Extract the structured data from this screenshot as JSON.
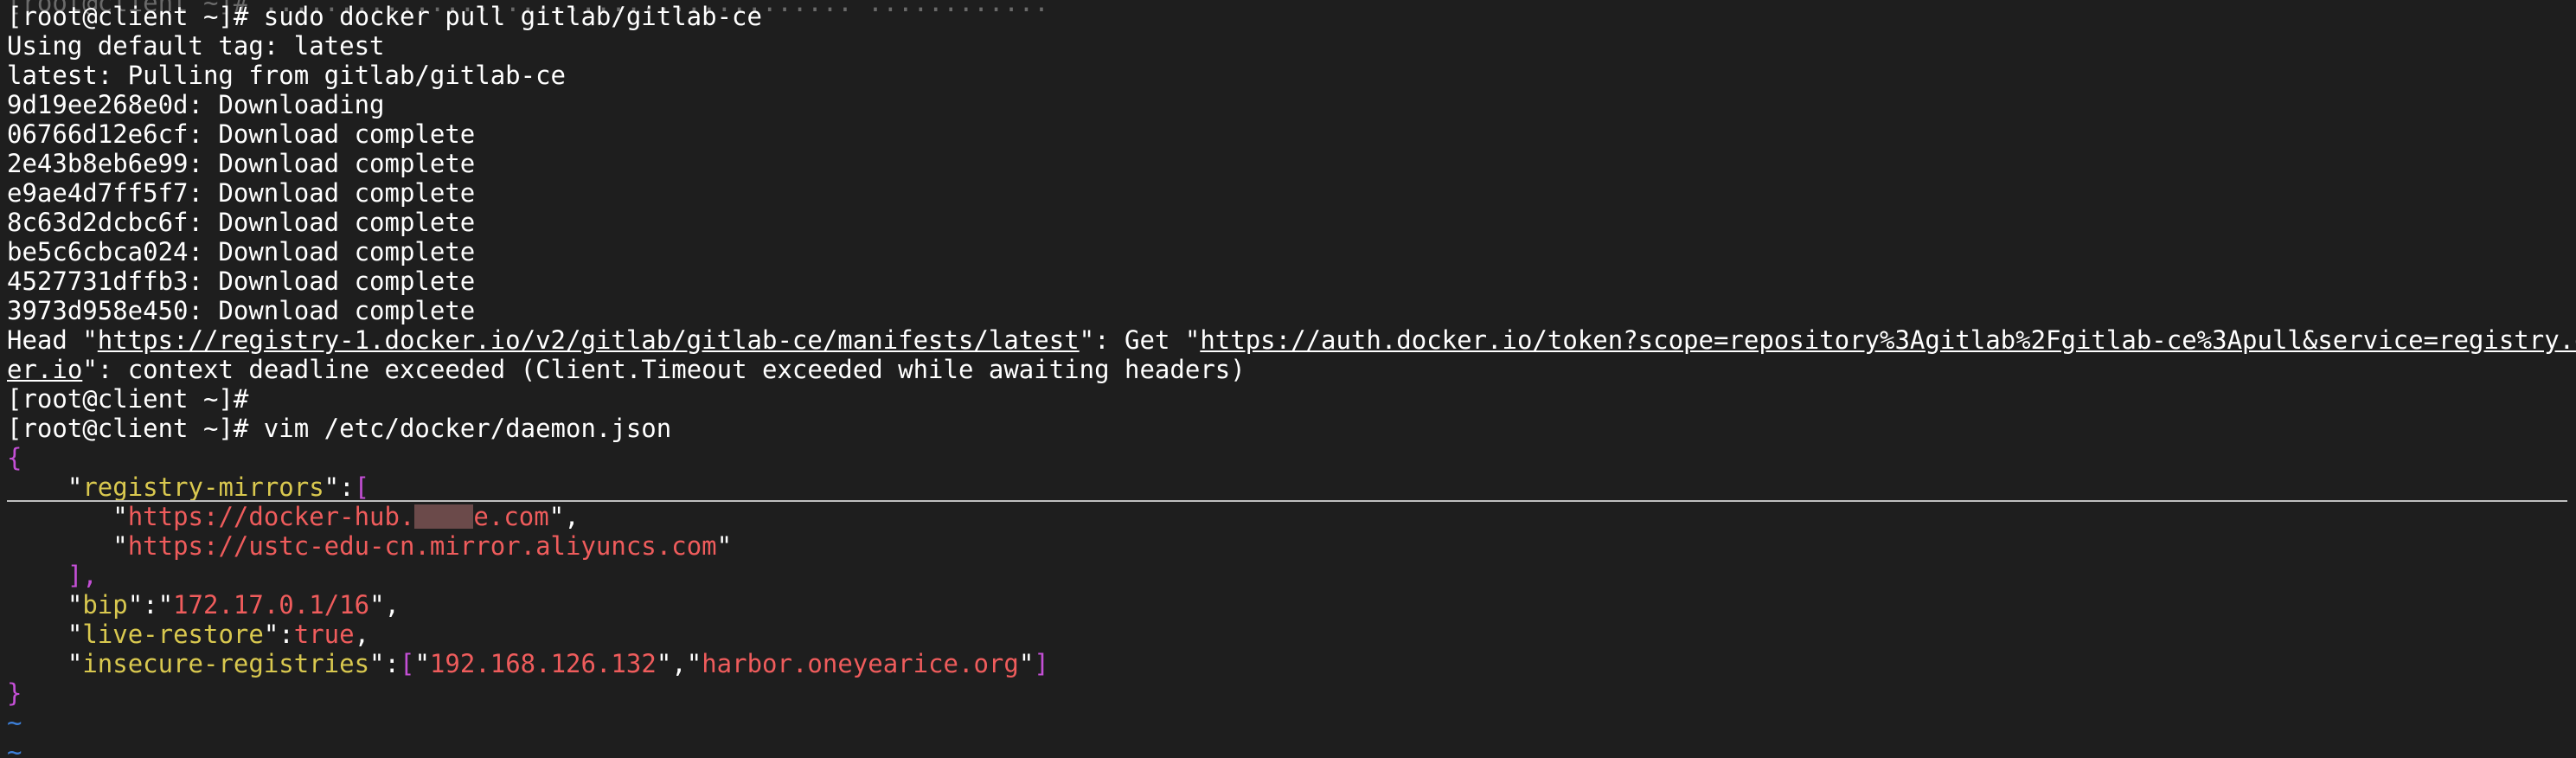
{
  "terminal": {
    "top_remnant": "[root@client ~]# ....................................... ............",
    "lines": {
      "l1": "[root@client ~]# sudo docker pull gitlab/gitlab-ce",
      "l2": "Using default tag: latest",
      "l3": "latest: Pulling from gitlab/gitlab-ce",
      "l4": "9d19ee268e0d: Downloading",
      "l5": "06766d12e6cf: Download complete",
      "l6": "2e43b8eb6e99: Download complete",
      "l7": "e9ae4d7ff5f7: Download complete",
      "l8": "8c63d2dcbc6f: Download complete",
      "l9": "be5c6cbca024: Download complete",
      "l10": "4527731dffb3: Download complete",
      "l11": "3973d958e450: Download complete"
    },
    "head_line": {
      "prefix": "Head \"",
      "url1": "https://registry-1.docker.io/v2/gitlab/gitlab-ce/manifests/latest",
      "middle": "\": Get \"",
      "url2_part1": "https://auth.docker.io/token?scope=repository%3Agitlab%2Fgitlab-ce%3Apull&service=registry.dock",
      "url2_part2": "er.io",
      "suffix": "\": context deadline exceeded (Client.Timeout exceeded while awaiting headers)"
    },
    "prompt_empty": "[root@client ~]#",
    "prompt_vim": "[root@client ~]# vim /etc/docker/daemon.json"
  },
  "editor": {
    "open_brace": "{",
    "indent": "    ",
    "indent2": "       ",
    "key_registry_mirrors": "registry-mirrors",
    "open_bracket": "[",
    "mirror1_before": "https://docker-hub.",
    "mirror1_after": "e.com",
    "mirror2": "https://ustc-edu-cn.mirror.aliyuncs.com",
    "close_bracket": "],",
    "key_bip": "bip",
    "val_bip": "172.17.0.1/16",
    "key_live_restore": "live-restore",
    "val_live_restore": "true",
    "key_insecure": "insecure-registries",
    "insecure1": "192.168.126.132",
    "insecure2": "harbor.oneyearice.org",
    "close_brace": "}",
    "tilde": "~"
  },
  "colors": {
    "background": "#1e1e1e",
    "text": "#ffffff",
    "brace": "#c44fd6",
    "key": "#d9c84f",
    "string": "#ef5c5c",
    "tilde": "#3d7fd8"
  }
}
